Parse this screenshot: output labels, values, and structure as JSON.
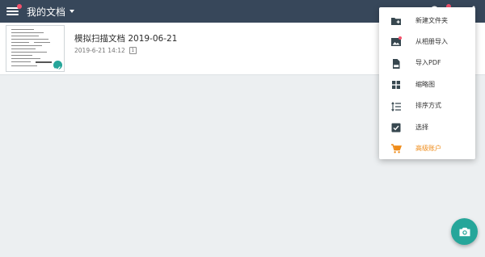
{
  "app_bar": {
    "title": "我的文档",
    "icons": [
      "menu-icon",
      "caret-down-icon",
      "search-icon",
      "more-vert-icon"
    ],
    "background": "#37475a",
    "badge_color": "#f4516c"
  },
  "documents": [
    {
      "name": "模拟扫描文档 2019-06-21",
      "date": "2019-6-21 14:12",
      "page_count": "1",
      "synced": true
    }
  ],
  "overflow_menu": {
    "items": [
      {
        "label": "新建文件夹",
        "icon": "new-folder-icon"
      },
      {
        "label": "从相册导入",
        "icon": "image-import-icon",
        "badge": true
      },
      {
        "label": "导入PDF",
        "icon": "pdf-icon"
      },
      {
        "label": "缩略图",
        "icon": "grid-view-icon"
      },
      {
        "label": "排序方式",
        "icon": "sort-icon"
      },
      {
        "label": "选择",
        "icon": "checkbox-icon"
      },
      {
        "label": "高级账户",
        "icon": "cart-icon",
        "highlight": true
      }
    ],
    "premium_color": "#ef8c1a"
  },
  "fab": {
    "icon": "camera-icon",
    "color": "#26a69a"
  }
}
